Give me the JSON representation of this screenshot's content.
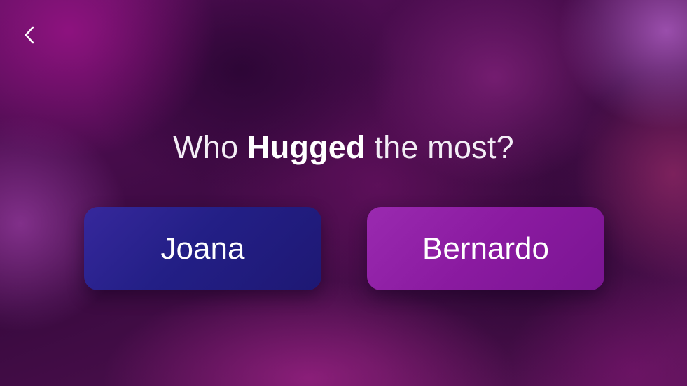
{
  "navigation": {
    "back_icon": "chevron-left-icon"
  },
  "question": {
    "prefix": "Who",
    "emphasis": "Hugged",
    "suffix": "the most?"
  },
  "choices": [
    {
      "label": "Joana",
      "color": "#231f86"
    },
    {
      "label": "Bernardo",
      "color": "#8a1aa0"
    }
  ],
  "colors": {
    "background": "#4a0f4e",
    "text": "#ffffff"
  }
}
